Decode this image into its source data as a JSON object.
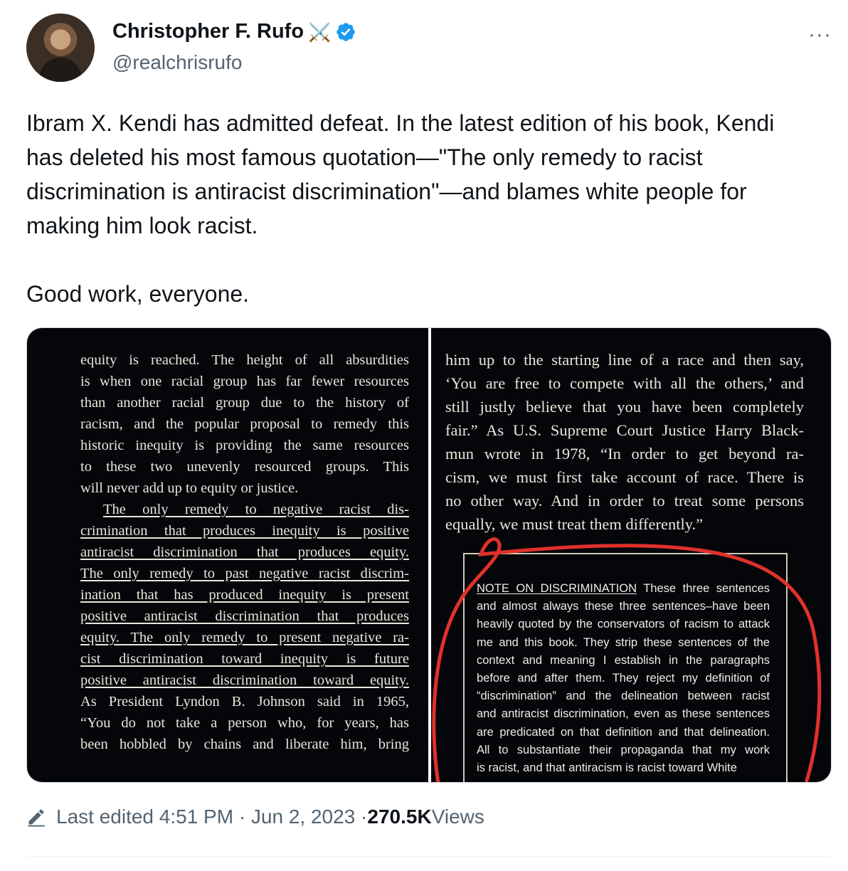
{
  "author": {
    "name": "Christopher F. Rufo",
    "emoji": "⚔️",
    "handle": "@realchrisrufo"
  },
  "tweet": {
    "text_p1": "Ibram X. Kendi has admitted defeat. In the latest edition of his book, Kendi has deleted his most famous quotation—\"The only remedy to racist discrimination is antiracist discrimination\"—and blames white people for making him look racist.",
    "text_p2": "Good work, everyone."
  },
  "book_left": {
    "lines": [
      "equity is reached. The height of all absurdities",
      "is when one racial group has far fewer resources",
      "than another racial group due to the history of",
      "racism, and the popular proposal to remedy this",
      "historic inequity is providing the same resources",
      "to these two unevenly resourced groups. This",
      "will never add up to equity or justice.",
      "The only remedy to negative racist dis-",
      "crimination that produces inequity is positive",
      "antiracist discrimination that produces equity.",
      "The only remedy to past negative racist discrim-",
      "ination that has produced inequity is present",
      "positive antiracist discrimination that produces",
      "equity. The only remedy to present negative ra-",
      "cist discrimination toward inequity is future",
      "positive antiracist discrimination toward equity.",
      "As President Lyndon B. Johnson said in 1965,",
      "“You do not take a person who, for years, has",
      "been hobbled by chains and liberate him, bring"
    ]
  },
  "book_right": {
    "lines": [
      "him up to the starting line of a race and then say,",
      "‘You are free to compete with all the others,’ and",
      "still justly believe that you have been completely",
      "fair.” As U.S. Supreme Court Justice Harry Black-",
      "mun wrote in 1978, “In order to get beyond ra-",
      "cism, we must first take account of race. There is",
      "no other way. And in order to treat some persons",
      "equally, we must treat them differently.”"
    ],
    "note_heading": "NOTE ON DISCRIMINATION",
    "note_first": " These three sentences",
    "note_lines": [
      "and almost always these three sentences–have been",
      "heavily quoted by the conservators of racism to attack",
      "me and this book. They strip these sentences of the",
      "context and meaning I establish in the paragraphs",
      "before and after them. They reject my definition of",
      "“discrimination” and the delineation between racist",
      "and antiracist discrimination, even as these sentences",
      "are predicated on that definition and that delineation.",
      "All to substantiate their propaganda that my work",
      "is racist, and that antiracism is racist toward White"
    ]
  },
  "footer": {
    "edited": "Last edited 4:51 PM · Jun 2, 2023 · ",
    "views_count": "270.5K",
    "views_label": " Views"
  },
  "colors": {
    "text": "#0f1419",
    "secondary": "#536471",
    "verified": "#1d9bf0",
    "annotation": "#e0312b"
  }
}
